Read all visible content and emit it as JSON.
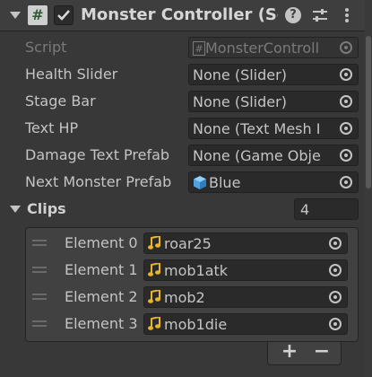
{
  "header": {
    "script_glyph": "#",
    "title": "Monster Controller (Scr",
    "help_glyph": "?",
    "enabled": true
  },
  "fields": [
    {
      "label": "Script",
      "value": "MonsterControll",
      "dim": true,
      "icon": "script-file-icon"
    },
    {
      "label": "Health Slider",
      "value": "None (Slider)"
    },
    {
      "label": "Stage Bar",
      "value": "None (Slider)"
    },
    {
      "label": "Text HP",
      "value": "None (Text Mesh I"
    },
    {
      "label": "Damage Text Prefab",
      "value": "None (Game Obje"
    },
    {
      "label": "Next Monster Prefab",
      "value": "Blue",
      "icon": "prefab-cube-icon"
    }
  ],
  "clips": {
    "label": "Clips",
    "size": "4",
    "elements": [
      {
        "label": "Element 0",
        "value": "roar25"
      },
      {
        "label": "Element 1",
        "value": "mob1atk"
      },
      {
        "label": "Element 2",
        "value": "mob2"
      },
      {
        "label": "Element 3",
        "value": "mob1die"
      }
    ],
    "add_label": "+",
    "remove_label": "−"
  },
  "colors": {
    "background": "#383838",
    "header": "#3e3e3e",
    "field": "#2a2a2a",
    "text": "#c4c4c4",
    "audio_icon": "#e8b42a",
    "prefab_icon": "#4fa3e0"
  }
}
